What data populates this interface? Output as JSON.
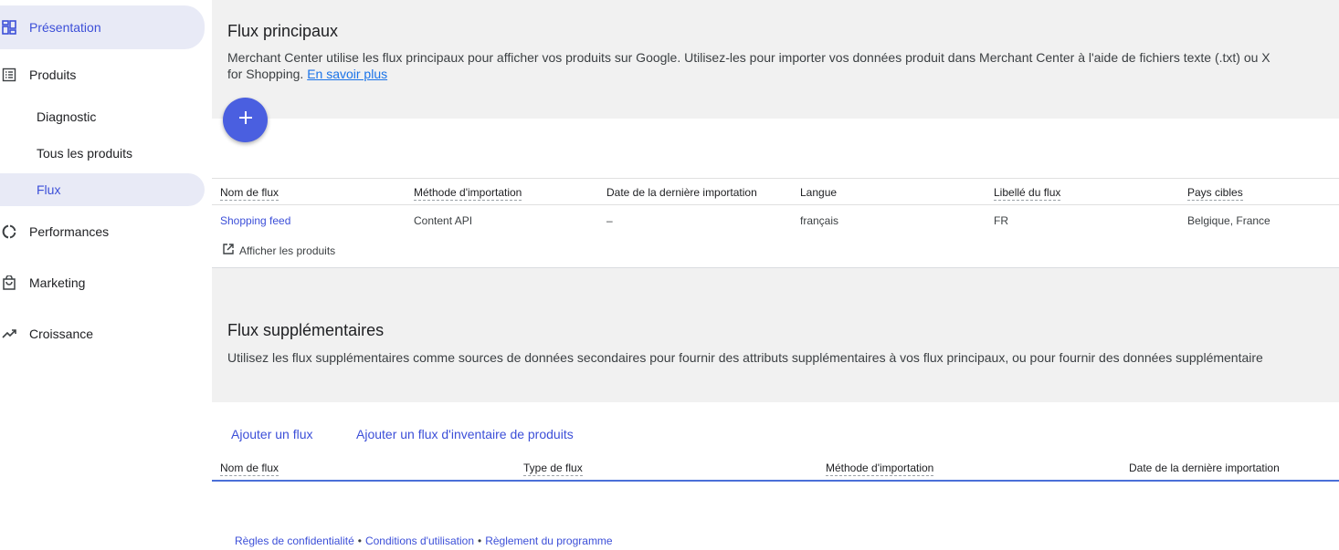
{
  "sidebar": {
    "items": [
      {
        "label": "Présentation",
        "icon": "dashboard-icon"
      },
      {
        "label": "Produits",
        "icon": "list-icon"
      },
      {
        "label": "Diagnostic"
      },
      {
        "label": "Tous les produits"
      },
      {
        "label": "Flux"
      },
      {
        "label": "Performances",
        "icon": "donut-icon"
      },
      {
        "label": "Marketing",
        "icon": "shopping-bag-icon"
      },
      {
        "label": "Croissance",
        "icon": "trending-up-icon"
      }
    ]
  },
  "primary": {
    "title": "Flux principaux",
    "description_line1": "Merchant Center utilise les flux principaux pour afficher vos produits sur Google. Utilisez-les pour importer vos données produit dans Merchant Center à l'aide de fichiers texte (.txt) ou X",
    "description_line2": "for Shopping.",
    "learn_more": "En savoir plus",
    "add_button_icon": "plus-icon",
    "columns": [
      "Nom de flux",
      "Méthode d'importation",
      "Date de la dernière importation",
      "Langue",
      "Libellé du flux",
      "Pays cibles"
    ],
    "row": {
      "name": "Shopping feed",
      "method": "Content API",
      "date": "–",
      "language": "français",
      "label": "FR",
      "countries": "Belgique, France"
    },
    "view_products": "Afficher les produits"
  },
  "supplemental": {
    "title": "Flux supplémentaires",
    "description": "Utilisez les flux supplémentaires comme sources de données secondaires pour fournir des attributs supplémentaires à vos flux principaux, ou pour fournir des données supplémentaire",
    "add_feed": "Ajouter un flux",
    "add_inventory_feed": "Ajouter un flux d'inventaire de produits",
    "columns": [
      "Nom de flux",
      "Type de flux",
      "Méthode d'importation",
      "Date de la dernière importation"
    ]
  },
  "footer": {
    "privacy": "Règles de confidentialité",
    "terms": "Conditions d'utilisation",
    "policy": "Règlement du programme",
    "separator": "•"
  },
  "colors": {
    "accent": "#3c4fd8",
    "fab": "#4a5fe0",
    "active_bg": "#e8eaf6"
  }
}
